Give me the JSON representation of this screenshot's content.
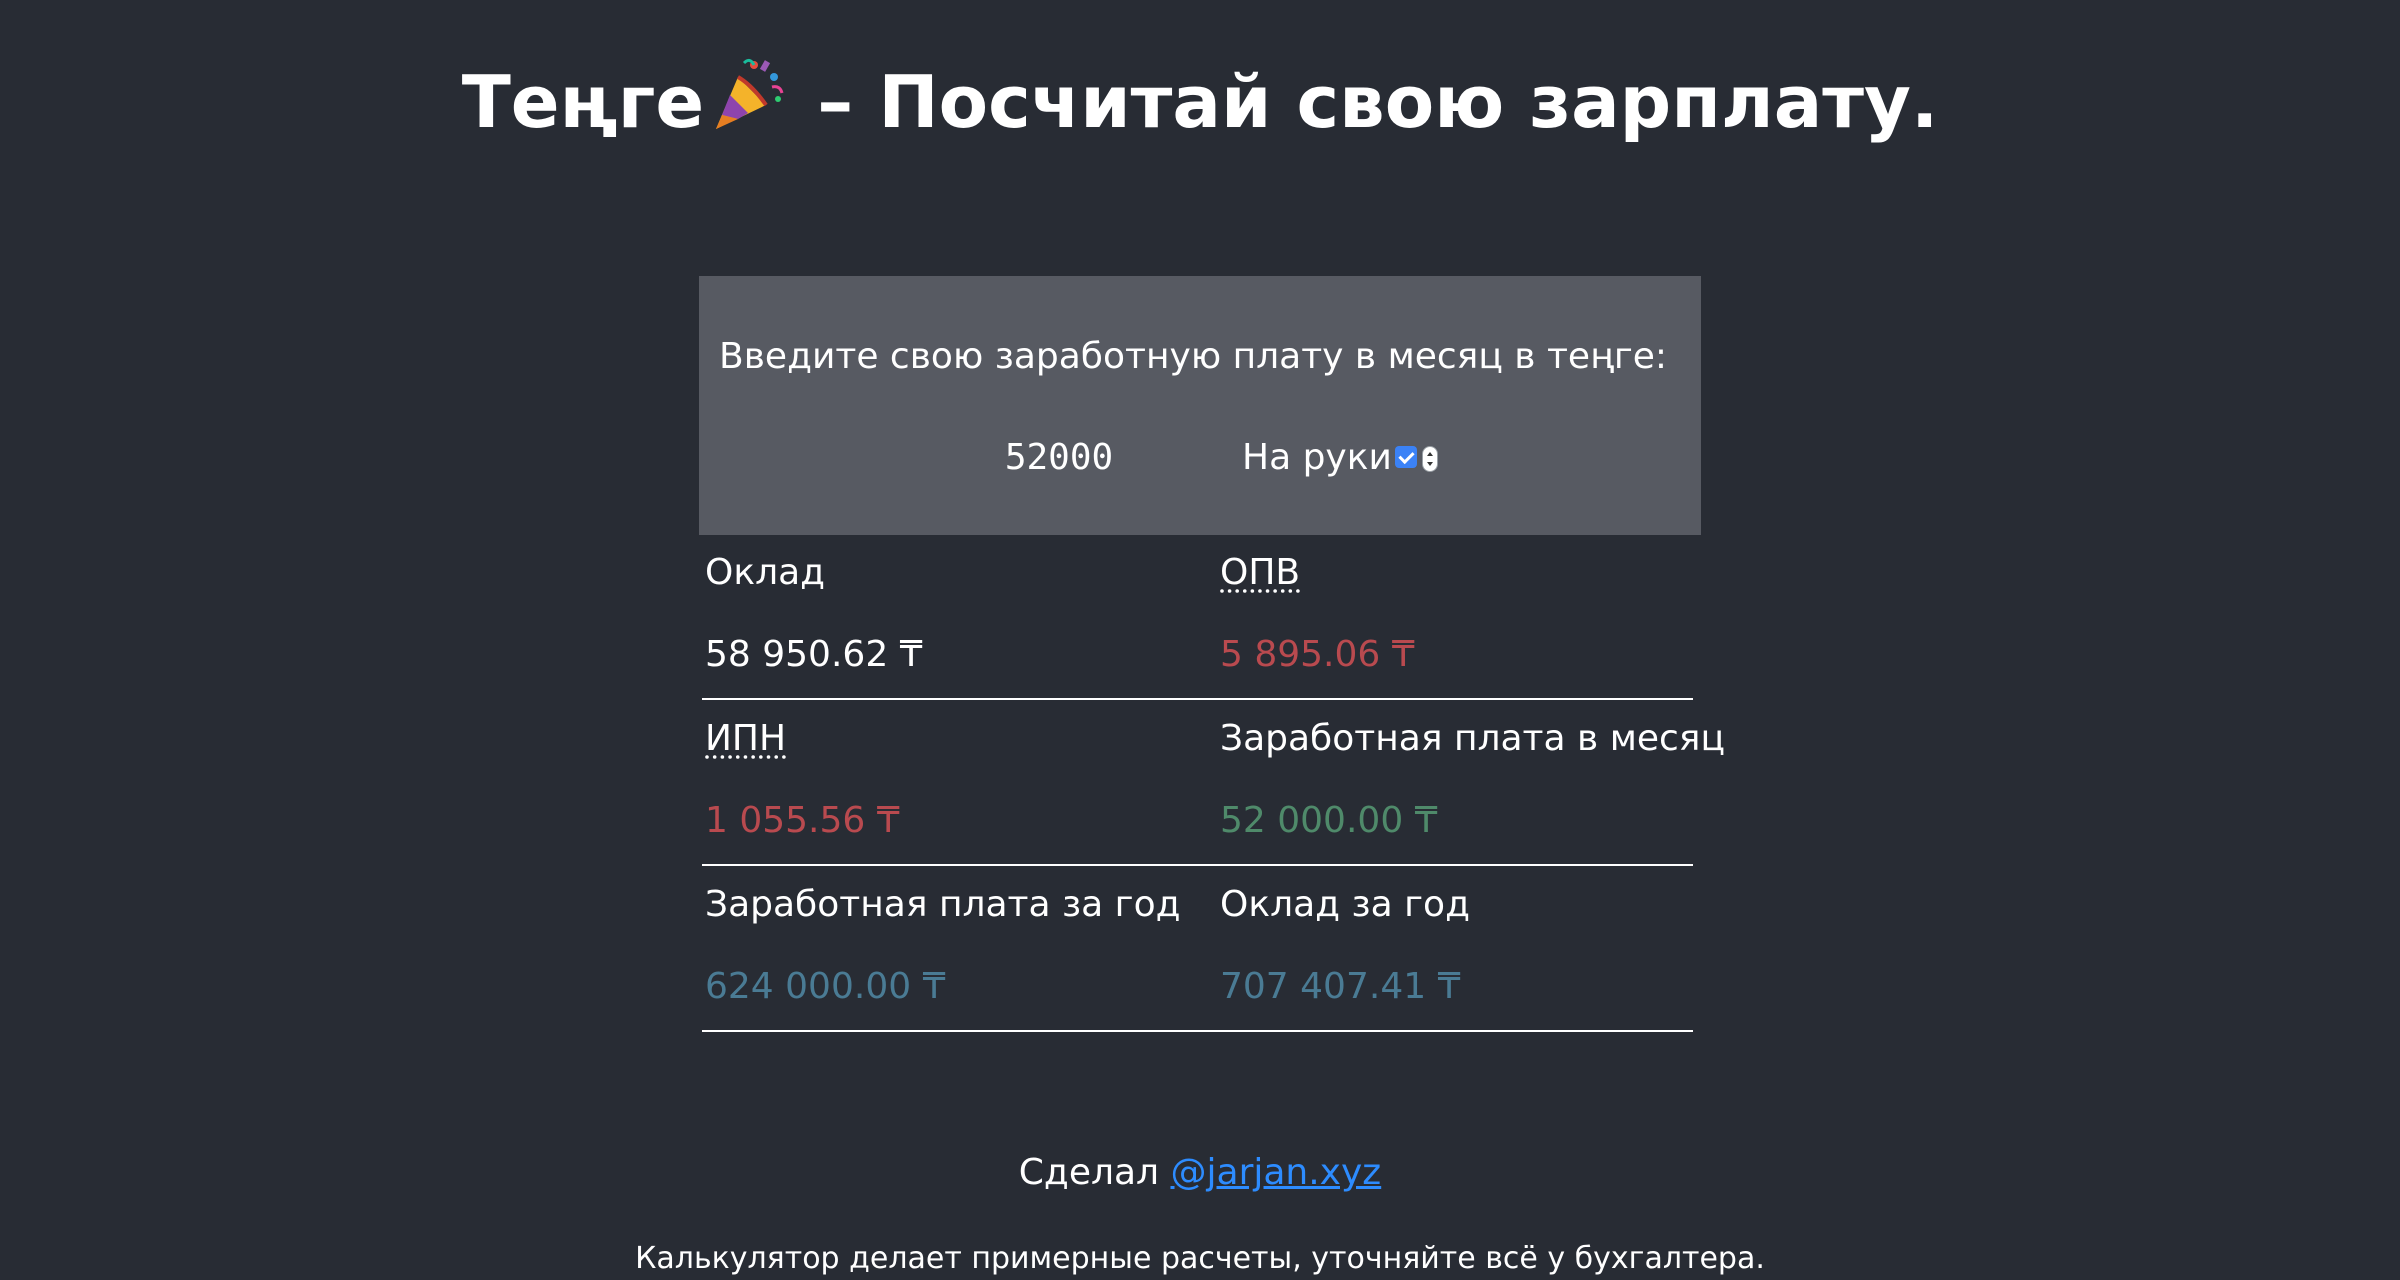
{
  "header": {
    "title_prefix": "Теңге",
    "title_suffix": " – Посчитай свою зарплату.",
    "title_icon": "party-popper-icon"
  },
  "input_panel": {
    "prompt": "Введите свою заработную плату в месяц в теңге:",
    "salary_value": "52000",
    "net_label": "На руки",
    "net_checked": true
  },
  "results": [
    {
      "label": "Оклад",
      "value": "58 950.62 ₸",
      "color": "#ffffff",
      "abbr": false
    },
    {
      "label": "ОПВ",
      "value": "5 895.06 ₸",
      "color": "#b94a4f",
      "abbr": true
    },
    {
      "label": "ИПН",
      "value": "1 055.56 ₸",
      "color": "#b94a4f",
      "abbr": true
    },
    {
      "label": "Заработная плата в месяц",
      "value": "52 000.00 ₸",
      "color": "#4f8a6a",
      "abbr": false
    },
    {
      "label": "Заработная плата за год",
      "value": "624 000.00 ₸",
      "color": "#4a7b94",
      "abbr": false
    },
    {
      "label": "Оклад за год",
      "value": "707 407.41 ₸",
      "color": "#4a7b94",
      "abbr": false
    }
  ],
  "footer": {
    "made_by": "Сделал ",
    "author_link": "@jarjan.xyz",
    "disclaimer": "Калькулятор делает примерные расчеты, уточняйте всё у бухгалтера."
  },
  "colors": {
    "background": "#282c34",
    "panel": "#575a62",
    "link": "#2d8cff",
    "negative": "#b94a4f",
    "positive": "#4f8a6a",
    "annual": "#4a7b94"
  }
}
